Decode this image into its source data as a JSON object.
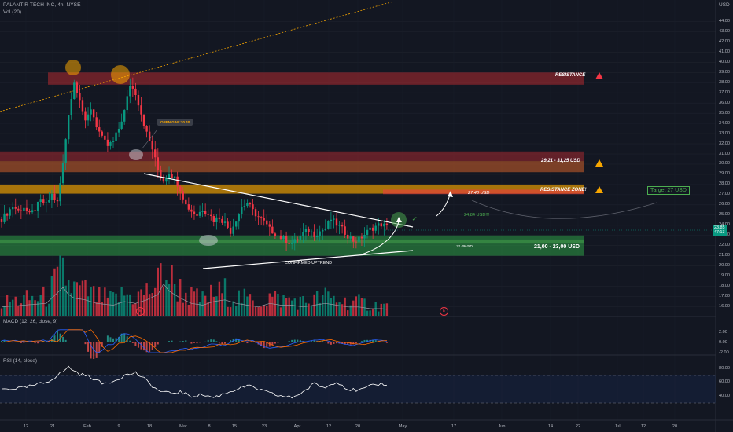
{
  "header": {
    "title": "PALANTIR TECH INC, 4h, NYSE",
    "volume_indicator": "Vol (20)"
  },
  "currency": "USD",
  "panels": {
    "macd_label": "MACD (12, 26, close, 9)",
    "rsi_label": "RSI (14, close)"
  },
  "annotations": {
    "resistance": "RESISTANCE",
    "band_29_31": "29,21 - 31,25 USD",
    "resistance_zone": "RESISTANCE ZONE!",
    "price_27_40": "27,40 USD",
    "price_24_84": "24,84 USD!!!",
    "support_zone": "21,00 - 23,00 USD",
    "support_small": "22.49USD",
    "confirmed_uptrend": "CONFIRMED UPTREND",
    "open_gap": "OPEN GAP:30.40",
    "target": "Target 27 USD",
    "last_price_1": "23.85",
    "last_price_2": "47:13",
    "marker_e1": "E",
    "marker_e2": "E"
  },
  "colors": {
    "background": "#131722",
    "up": "#089981",
    "down": "#f23645",
    "resistance_band": "#b22a30",
    "orange_band": "#f7a600",
    "support_band": "#2e9e46",
    "white_line": "#ffffff"
  },
  "chart_data": {
    "type": "candlestick",
    "title": "PALANTIR TECH INC, 4h, NYSE",
    "y_axis": {
      "ticks": [
        16.0,
        17.0,
        18.0,
        19.0,
        20.0,
        21.0,
        22.0,
        23.0,
        24.0,
        25.0,
        26.0,
        27.0,
        28.0,
        29.0,
        30.0,
        31.0,
        32.0,
        33.0,
        34.0,
        35.0,
        36.0,
        37.0,
        38.0,
        39.0,
        40.0,
        41.0,
        42.0,
        43.0,
        44.0
      ],
      "tick_labels": [
        "16.00",
        "17.00",
        "18.00",
        "19.00",
        "20.00",
        "21.00",
        "22.00",
        "23.00",
        "24.00",
        "25.00",
        "26.00",
        "27.00",
        "28.00",
        "29.00",
        "30.00",
        "31.00",
        "32.00",
        "33.00",
        "34.00",
        "35.00",
        "36.00",
        "37.00",
        "38.00",
        "39.00",
        "40.00",
        "41.00",
        "42.00",
        "43.00",
        "44.00"
      ],
      "range": [
        15.5,
        45.5
      ]
    },
    "x_axis": {
      "tick_labels": [
        "12",
        "21",
        "Feb",
        "9",
        "18",
        "Mar",
        "8",
        "15",
        "23",
        "Apr",
        "12",
        "20",
        "May",
        "17",
        "Jun",
        "14",
        "22",
        "Jul",
        "12",
        "20"
      ]
    },
    "close_path": [
      [
        0,
        24.6
      ],
      [
        2,
        25.2
      ],
      [
        4,
        25.9
      ],
      [
        6,
        25.4
      ],
      [
        8,
        25.8
      ],
      [
        10,
        25.0
      ],
      [
        12,
        25.6
      ],
      [
        14,
        26.4
      ],
      [
        16,
        26.0
      ],
      [
        18,
        27.0
      ],
      [
        20,
        26.2
      ],
      [
        22,
        30.0
      ],
      [
        24,
        35.0
      ],
      [
        26,
        38.0
      ],
      [
        28,
        36.5
      ],
      [
        30,
        34.0
      ],
      [
        32,
        35.5
      ],
      [
        34,
        33.8
      ],
      [
        36,
        32.5
      ],
      [
        38,
        31.8
      ],
      [
        40,
        32.2
      ],
      [
        42,
        33.5
      ],
      [
        44,
        35.2
      ],
      [
        46,
        37.8
      ],
      [
        48,
        37.0
      ],
      [
        50,
        35.0
      ],
      [
        52,
        33.0
      ],
      [
        54,
        31.5
      ],
      [
        56,
        29.4
      ],
      [
        58,
        28.4
      ],
      [
        60,
        29.2
      ],
      [
        62,
        28.6
      ],
      [
        64,
        27.6
      ],
      [
        66,
        26.0
      ],
      [
        68,
        25.4
      ],
      [
        70,
        25.0
      ],
      [
        72,
        25.6
      ],
      [
        74,
        25.2
      ],
      [
        76,
        24.5
      ],
      [
        78,
        24.8
      ],
      [
        80,
        24.2
      ],
      [
        82,
        23.4
      ],
      [
        84,
        24.6
      ],
      [
        86,
        25.8
      ],
      [
        88,
        26.2
      ],
      [
        90,
        25.4
      ],
      [
        92,
        24.8
      ],
      [
        94,
        24.3
      ],
      [
        96,
        23.6
      ],
      [
        98,
        23.2
      ],
      [
        100,
        22.8
      ],
      [
        102,
        22.5
      ],
      [
        104,
        22.2
      ],
      [
        106,
        22.6
      ],
      [
        108,
        23.2
      ],
      [
        110,
        23.5
      ],
      [
        112,
        23.1
      ],
      [
        114,
        23.4
      ],
      [
        116,
        23.7
      ],
      [
        118,
        24.6
      ],
      [
        120,
        24.1
      ],
      [
        122,
        23.6
      ],
      [
        124,
        23.0
      ],
      [
        126,
        22.5
      ],
      [
        128,
        22.6
      ],
      [
        130,
        23.1
      ],
      [
        132,
        23.6
      ],
      [
        134,
        23.9
      ],
      [
        136,
        24.1
      ],
      [
        138,
        23.85
      ]
    ],
    "volume_profile": [
      [
        0,
        0.25
      ],
      [
        8,
        0.3
      ],
      [
        16,
        0.35
      ],
      [
        22,
        0.8
      ],
      [
        24,
        0.6
      ],
      [
        26,
        0.5
      ],
      [
        30,
        0.45
      ],
      [
        34,
        0.35
      ],
      [
        40,
        0.3
      ],
      [
        44,
        0.4
      ],
      [
        48,
        0.35
      ],
      [
        52,
        0.45
      ],
      [
        56,
        0.6
      ],
      [
        58,
        0.9
      ],
      [
        60,
        0.7
      ],
      [
        64,
        0.5
      ],
      [
        68,
        0.35
      ],
      [
        72,
        0.3
      ],
      [
        76,
        0.4
      ],
      [
        80,
        0.45
      ],
      [
        84,
        0.35
      ],
      [
        88,
        0.3
      ],
      [
        92,
        0.25
      ],
      [
        96,
        0.35
      ],
      [
        100,
        0.3
      ],
      [
        104,
        0.3
      ],
      [
        108,
        0.25
      ],
      [
        112,
        0.3
      ],
      [
        116,
        0.35
      ],
      [
        120,
        0.3
      ],
      [
        124,
        0.25
      ],
      [
        128,
        0.25
      ],
      [
        132,
        0.2
      ],
      [
        136,
        0.2
      ],
      [
        138,
        0.18
      ]
    ],
    "rsi_path": [
      [
        0,
        50
      ],
      [
        8,
        52
      ],
      [
        16,
        60
      ],
      [
        20,
        70
      ],
      [
        24,
        82
      ],
      [
        28,
        72
      ],
      [
        32,
        68
      ],
      [
        36,
        58
      ],
      [
        40,
        62
      ],
      [
        44,
        70
      ],
      [
        48,
        74
      ],
      [
        52,
        62
      ],
      [
        56,
        48
      ],
      [
        60,
        44
      ],
      [
        64,
        46
      ],
      [
        68,
        40
      ],
      [
        72,
        42
      ],
      [
        76,
        38
      ],
      [
        80,
        44
      ],
      [
        84,
        50
      ],
      [
        88,
        55
      ],
      [
        92,
        50
      ],
      [
        96,
        44
      ],
      [
        100,
        40
      ],
      [
        104,
        38
      ],
      [
        108,
        46
      ],
      [
        112,
        58
      ],
      [
        116,
        52
      ],
      [
        120,
        62
      ],
      [
        124,
        50
      ],
      [
        128,
        48
      ],
      [
        132,
        54
      ],
      [
        136,
        58
      ],
      [
        138,
        57
      ]
    ],
    "rsi_ticks": [
      40.0,
      60.0,
      80.0
    ],
    "rsi_tick_labels": [
      "40.00",
      "60.00",
      "80.00"
    ],
    "macd_ticks": [
      -2.0,
      0.0,
      2.0
    ],
    "macd_tick_labels": [
      "-2.00",
      "0.00",
      "2.00"
    ],
    "zones": [
      {
        "name": "resistance",
        "from": 37.8,
        "to": 39.0
      },
      {
        "name": "open-gap-upper",
        "from": 30.3,
        "to": 31.25
      },
      {
        "name": "band-29-31",
        "from": 29.21,
        "to": 30.3
      },
      {
        "name": "resistance-zone",
        "from": 27.1,
        "to": 28.0
      },
      {
        "name": "support-outer",
        "from": 21.0,
        "to": 23.0
      },
      {
        "name": "support-inner",
        "from": 22.2,
        "to": 22.6
      }
    ]
  }
}
